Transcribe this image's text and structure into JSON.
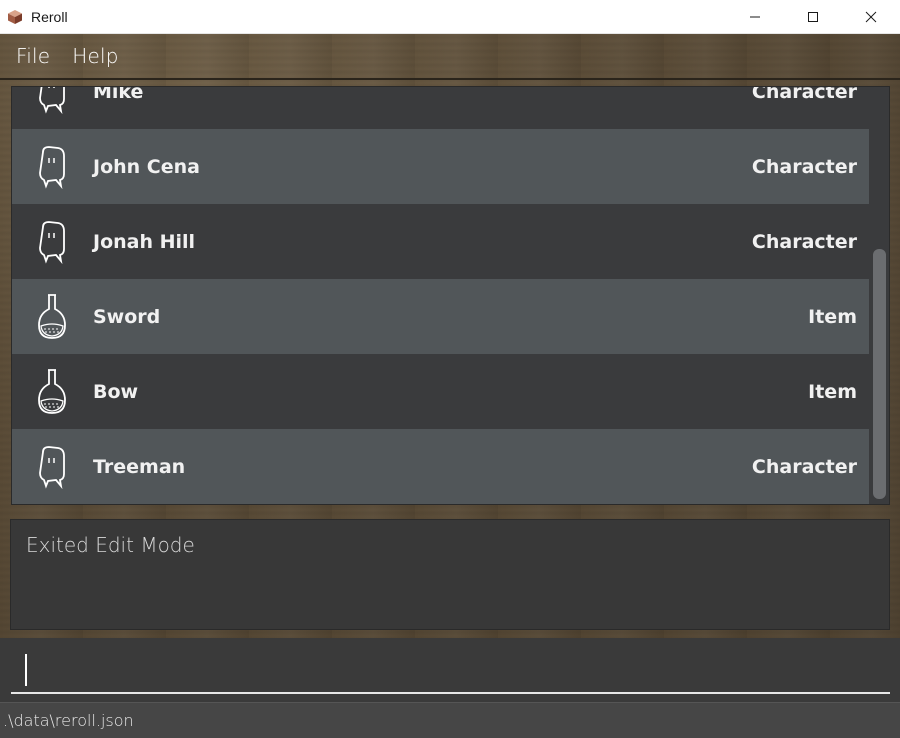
{
  "window": {
    "title": "Reroll",
    "app_icon": "cube-icon",
    "controls": [
      "minimize-icon",
      "maximize-icon",
      "close-icon"
    ]
  },
  "menu": {
    "items": [
      {
        "label": "File"
      },
      {
        "label": "Help"
      }
    ]
  },
  "entities": [
    {
      "name": "Mike",
      "type": "Character",
      "icon": "ghost-icon"
    },
    {
      "name": "John Cena",
      "type": "Character",
      "icon": "ghost-icon"
    },
    {
      "name": "Jonah Hill",
      "type": "Character",
      "icon": "ghost-icon"
    },
    {
      "name": "Sword",
      "type": "Item",
      "icon": "potion-icon"
    },
    {
      "name": "Bow",
      "type": "Item",
      "icon": "potion-icon"
    },
    {
      "name": "Treeman",
      "type": "Character",
      "icon": "ghost-icon"
    }
  ],
  "result": {
    "message": "Exited Edit Mode"
  },
  "command": {
    "value": ""
  },
  "status": {
    "file_path": ".\\data\\reroll.json"
  }
}
